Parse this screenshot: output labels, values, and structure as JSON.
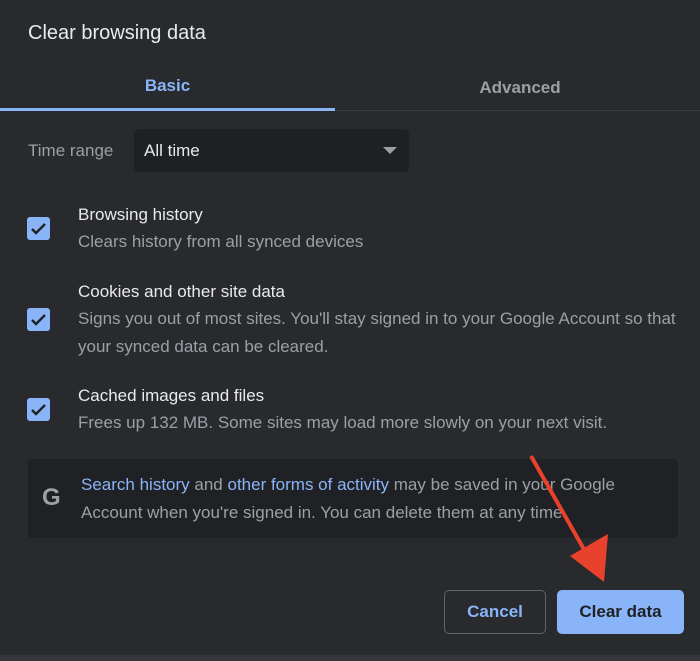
{
  "dialog": {
    "title": "Clear browsing data"
  },
  "tabs": [
    {
      "label": "Basic",
      "active": true
    },
    {
      "label": "Advanced",
      "active": false
    }
  ],
  "time_range": {
    "label": "Time range",
    "value": "All time"
  },
  "items": [
    {
      "title": "Browsing history",
      "desc": "Clears history from all synced devices",
      "checked": true
    },
    {
      "title": "Cookies and other site data",
      "desc": "Signs you out of most sites. You'll stay signed in to your Google Account so that your synced data can be cleared.",
      "checked": true
    },
    {
      "title": "Cached images and files",
      "desc": "Frees up 132 MB. Some sites may load more slowly on your next visit.",
      "checked": true
    }
  ],
  "info": {
    "icon": "G",
    "link1": "Search history",
    "t1": " and ",
    "link2": "other forms of activity",
    "t2": " may be saved in your Google Account when you're signed in. You can delete them at any time."
  },
  "buttons": {
    "cancel": "Cancel",
    "clear": "Clear data"
  },
  "colors": {
    "accent": "#8ab4f8",
    "background": "#292a2d",
    "annotation": "#e8412c"
  }
}
